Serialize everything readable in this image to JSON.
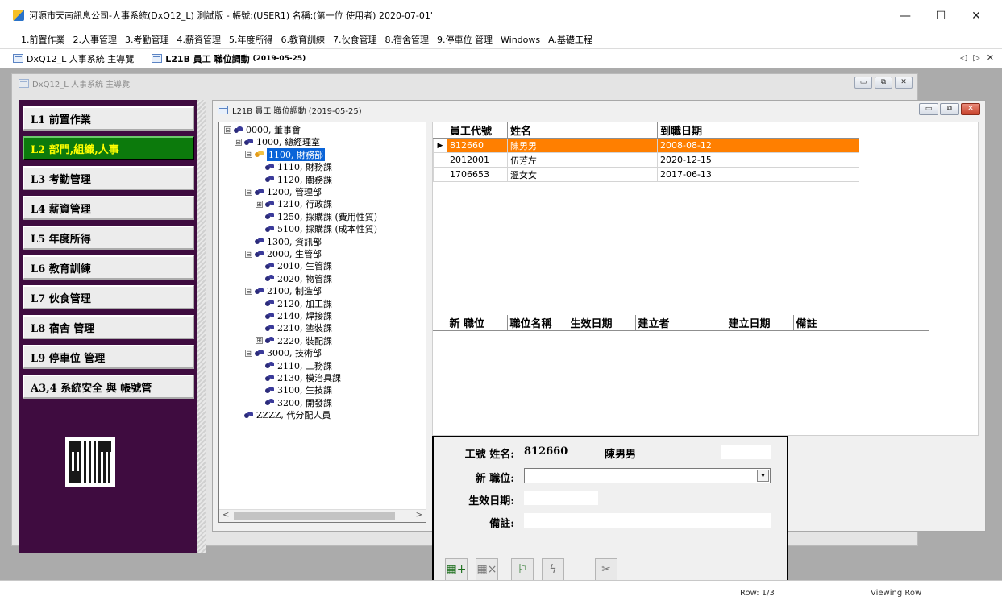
{
  "window": {
    "title": "河源市天南訊息公司-人事系統(DxQ12_L) 測試版 - 帳號:(USER1) 名稱:(第一位 使用者) 2020-07-01'",
    "controls": {
      "minimize": "—",
      "maximize": "☐",
      "close": "✕"
    }
  },
  "menu": [
    "1.前置作業",
    "2.人事管理",
    "3.考勤管理",
    "4.薪資管理",
    "5.年度所得",
    "6.教育訓練",
    "7.伙食管理",
    "8.宿舍管理",
    "9.停車位 管理",
    "Windows",
    "A.基礎工程"
  ],
  "tabs": [
    {
      "label": "DxQ12_L 人事系統 主導覽",
      "small": ""
    },
    {
      "label": "L21B 員工 職位調動",
      "small": "(2019-05-25)"
    }
  ],
  "tab_nav": {
    "left": "◁",
    "right": "▷",
    "close": "✕"
  },
  "outer_window": {
    "title": "DxQ12_L 人事系統 主導覽",
    "controls": {
      "minimize": "▭",
      "restore": "⧉",
      "close": "✕"
    }
  },
  "nav": {
    "items": [
      "L1  前置作業",
      "L2  部門,組織,人事",
      "L3  考勤管理",
      "L4  薪資管理",
      "L5  年度所得",
      "L6  教育訓練",
      "L7  伙食管理",
      "L8  宿舍  管理",
      "L9  停車位  管理",
      "A3,4  系統安全  與  帳號管"
    ],
    "active_index": 1,
    "active_color": "#0c7a0c",
    "active_text_color": "#ffff00",
    "panel_color": "#3f0c40"
  },
  "inner_window": {
    "title": "L21B 員工 職位調動 (2019-05-25)",
    "controls": {
      "minimize": "▭",
      "restore": "⧉",
      "close": "✕"
    }
  },
  "tree": {
    "nodes": [
      {
        "label": "0000,  董事會",
        "toggle": "⊟",
        "selected": false,
        "open": false
      },
      {
        "label": "1000,  總經理室",
        "toggle": "⊟",
        "selected": false,
        "open": false
      },
      {
        "label": "1100,  財務部",
        "toggle": "⊟",
        "selected": true,
        "open": true
      },
      {
        "label": "1110,  財務課",
        "toggle": "",
        "selected": false,
        "open": false
      },
      {
        "label": "1120,  關務課",
        "toggle": "",
        "selected": false,
        "open": false
      },
      {
        "label": "1200,  管理部",
        "toggle": "⊟",
        "selected": false,
        "open": false
      },
      {
        "label": "1210,  行政課",
        "toggle": "⊞",
        "selected": false,
        "open": false
      },
      {
        "label": "1250,  採購課 (費用性質)",
        "toggle": "",
        "selected": false,
        "open": false
      },
      {
        "label": "5100,  採購課 (成本性質)",
        "toggle": "",
        "selected": false,
        "open": false
      },
      {
        "label": "1300,  資訊部",
        "toggle": "",
        "selected": false,
        "open": false
      },
      {
        "label": "2000,  生管部",
        "toggle": "⊟",
        "selected": false,
        "open": false
      },
      {
        "label": "2010,  生管課",
        "toggle": "",
        "selected": false,
        "open": false
      },
      {
        "label": "2020,  物管課",
        "toggle": "",
        "selected": false,
        "open": false
      },
      {
        "label": "2100,  制造部",
        "toggle": "⊟",
        "selected": false,
        "open": false
      },
      {
        "label": "2120,  加工課",
        "toggle": "",
        "selected": false,
        "open": false
      },
      {
        "label": "2140,  焊接課",
        "toggle": "",
        "selected": false,
        "open": false
      },
      {
        "label": "2210,  塗裝課",
        "toggle": "",
        "selected": false,
        "open": false
      },
      {
        "label": "2220,  裝配課",
        "toggle": "⊞",
        "selected": false,
        "open": false
      },
      {
        "label": "3000,  技術部",
        "toggle": "⊟",
        "selected": false,
        "open": false
      },
      {
        "label": "2110,  工務課",
        "toggle": "",
        "selected": false,
        "open": false
      },
      {
        "label": "2130,  模治具課",
        "toggle": "",
        "selected": false,
        "open": false
      },
      {
        "label": "3100,  生技課",
        "toggle": "",
        "selected": false,
        "open": false
      },
      {
        "label": "3200,  開發課",
        "toggle": "",
        "selected": false,
        "open": false
      },
      {
        "label": "ZZZZ,  代分配人員",
        "toggle": "",
        "selected": false,
        "open": false
      }
    ],
    "scroll": {
      "left": "<",
      "right": ">"
    }
  },
  "employee_grid": {
    "columns": [
      "員工代號",
      "姓名",
      "到職日期"
    ],
    "current_row_marker": "▶",
    "rows": [
      {
        "id": "812660",
        "name": "陳男男",
        "date": "2008-08-12",
        "selected": true
      },
      {
        "id": "2012001",
        "name": "伍芳左",
        "date": "2020-12-15",
        "selected": false
      },
      {
        "id": "1706653",
        "name": "溫女女",
        "date": "2017-06-13",
        "selected": false
      }
    ],
    "selected_color": "#ff7f00"
  },
  "position_grid": {
    "columns": [
      "新 職位",
      "職位名稱",
      "生效日期",
      "建立者",
      "建立日期",
      "備註"
    ]
  },
  "edit_form": {
    "emp_label": "工號 姓名:",
    "emp_id": "812660",
    "emp_name": "陳男男",
    "position_label": "新  職位:",
    "position_value": "",
    "dropdown_glyph": "▾",
    "effective_date_label": "生效日期:",
    "effective_date_value": "",
    "remark_label": "備註:",
    "remark_value": ""
  },
  "toolbar": {
    "buttons": [
      {
        "name": "add-record-button",
        "glyph": "▦+",
        "enabled": true
      },
      {
        "name": "delete-record-button",
        "glyph": "▦×",
        "enabled": false
      },
      {
        "name": "save-record-button",
        "glyph": "⚐",
        "enabled": true
      },
      {
        "name": "refresh-record-button",
        "glyph": "ϟ",
        "enabled": false
      },
      {
        "name": "cancel-record-button",
        "glyph": "✂",
        "enabled": false
      }
    ]
  },
  "status": {
    "row": "Row: 1/3",
    "mode": "Viewing Row"
  }
}
